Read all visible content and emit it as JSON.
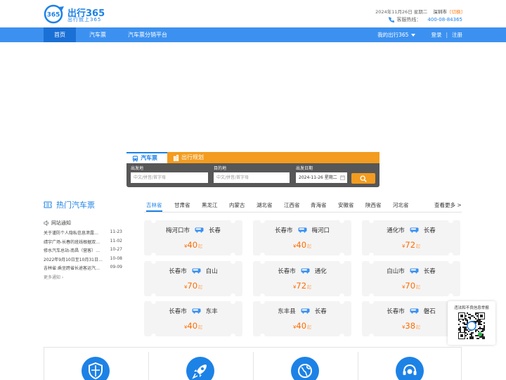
{
  "header": {
    "logo_name": "出行365",
    "logo_slogan": "出行就上365",
    "logo_mark_text": "365",
    "date_text": "2024年11月26日 星期二",
    "city": "深圳市",
    "switch_label": "[切换]",
    "hotline_label": "客服热线：",
    "hotline_number": "400-08-84365"
  },
  "nav": {
    "items": [
      "首页",
      "汽车票",
      "汽车票分销平台"
    ],
    "my_label": "我的出行365",
    "login_label": "登录",
    "divider": "|",
    "register_label": "注册"
  },
  "search": {
    "tab_bus": "汽车票",
    "tab_plan": "出行规划",
    "from_label": "出发地",
    "from_placeholder": "中文/拼音/首字母",
    "to_label": "目的地",
    "to_placeholder": "中文/拼音/首字母",
    "date_label": "出发日期",
    "date_value": "2024-11-26 星期二"
  },
  "hot": {
    "title": "热门汽车票",
    "more_label": "查看更多 >",
    "provinces": [
      "吉林省",
      "甘肃省",
      "黑龙江",
      "内蒙古",
      "湖北省",
      "江西省",
      "青海省",
      "安徽省",
      "陕西省",
      "河北省"
    ],
    "currency": "¥",
    "price_suffix": "起",
    "routes": [
      {
        "from": "梅河口市",
        "to": "长春",
        "price": "40"
      },
      {
        "from": "长春市",
        "to": "梅河口",
        "price": "40"
      },
      {
        "from": "通化市",
        "to": "长春",
        "price": "72"
      },
      {
        "from": "长春市",
        "to": "白山",
        "price": "70"
      },
      {
        "from": "长春市",
        "to": "通化",
        "price": "72"
      },
      {
        "from": "白山市",
        "to": "长春",
        "price": "70"
      },
      {
        "from": "长春市",
        "to": "东丰",
        "price": "40"
      },
      {
        "from": "东丰县",
        "to": "长春",
        "price": "40"
      },
      {
        "from": "长春市",
        "to": "磐石",
        "price": "38"
      }
    ]
  },
  "notice": {
    "title": "网站通知",
    "items": [
      {
        "text": "关于谨防个人隐私信息泄露…",
        "date": "11-23"
      },
      {
        "text": "靖宇广场-长春的班线根据双…",
        "date": "11-02"
      },
      {
        "text": "修水汽车总站-南昌（营客）…",
        "date": "10-27"
      },
      {
        "text": "2022年9月10日至10月31日…",
        "date": "10-08"
      },
      {
        "text": "吉林省:乘坐跨省长途客运汽…",
        "date": "09-09"
      }
    ],
    "more_label": "更多通知 ›"
  },
  "qr": {
    "title": "违法和不良信息举报"
  },
  "colors": {
    "brand_blue": "#1d82e6",
    "nav_blue": "#3c91f0",
    "accent_orange": "#f39c1f",
    "price_orange": "#ff6c00"
  }
}
